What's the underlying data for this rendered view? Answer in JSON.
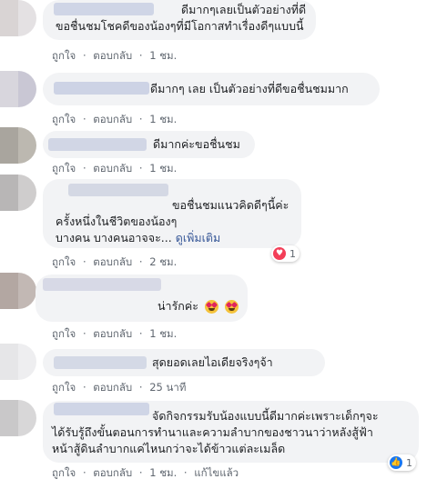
{
  "comments": [
    {
      "lines": [
        "ดีมากๆเลยเป็นตัวอย่างที่ดี",
        "ขอชื่นชมโชคดีของน้องๆที่มีโอกาสทำเรื่องดีๆแบบนี้"
      ],
      "like": "ถูกใจ",
      "reply": "ตอบกลับ",
      "time": "1 ชม."
    },
    {
      "lines": [
        "ดีมากๆ เลย เป็นตัวอย่างที่ดีขอชื่นชมมาก"
      ],
      "like": "ถูกใจ",
      "reply": "ตอบกลับ",
      "time": "1 ชม."
    },
    {
      "lines": [
        "ดีมากค่ะขอชื่นชม"
      ],
      "like": "ถูกใจ",
      "reply": "ตอบกลับ",
      "time": "1 ชม."
    },
    {
      "lines": [
        "ขอชื่นชมแนวคิดดีๆนี้ค่ะ",
        "ครั้งหนึ่งในชีวิตของน้องๆ",
        "บางคน บางคนอาจจะ..."
      ],
      "see_more": "ดูเพิ่มเติม",
      "reaction_count": "1",
      "like": "ถูกใจ",
      "reply": "ตอบกลับ",
      "time": "2 ชม."
    },
    {
      "lines": [
        "น่ารักค่ะ"
      ],
      "like": "ถูกใจ",
      "reply": "ตอบกลับ",
      "time": "1 ชม."
    },
    {
      "lines": [
        "สุดยอดเลยไอเดียจริงๆจ้า"
      ],
      "like": "ถูกใจ",
      "reply": "ตอบกลับ",
      "time": "25 นาที"
    },
    {
      "lines": [
        "จัดกิจกรรมรับน้องแบบนี้ดีมากค่ะเพราะเด็กๆจะ",
        "ได้รับรู้ถึงขั้นตอนการทำนาและความลำบากของชาวนาว่าหลังสู้ฟ้า",
        "หน้าสู้ดินลำบากแค่ไหนกว่าจะได้ข้าวแต่ละเมล็ด"
      ],
      "reaction_count": "1",
      "like": "ถูกใจ",
      "reply": "ตอบกลับ",
      "time": "1 ชม.",
      "edited": "แก้ไขแล้ว"
    }
  ],
  "separator": "·",
  "colors": {
    "bubble": "#f2f3f5",
    "link": "#385898",
    "meta": "#606770",
    "love": "#f33e58",
    "like": "#1877f2"
  }
}
